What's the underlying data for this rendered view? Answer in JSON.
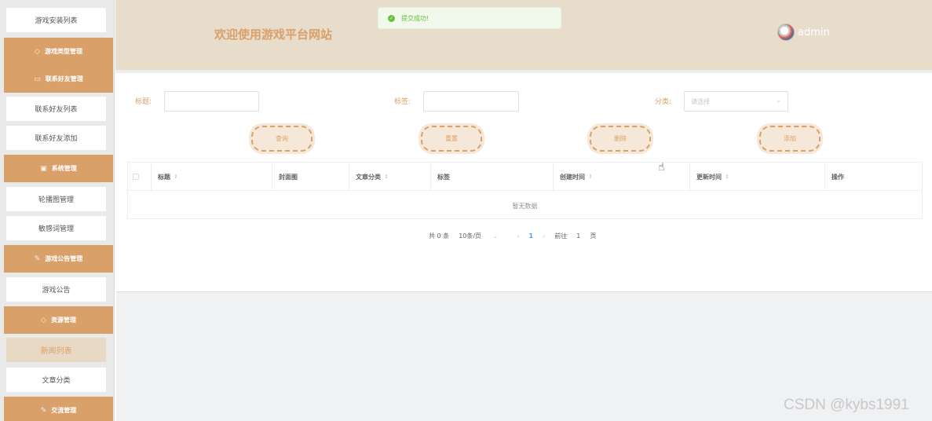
{
  "sidebar": {
    "items": [
      {
        "label": "游戏安装列表"
      },
      {
        "label": "联系好友列表"
      },
      {
        "label": "联系好友添加"
      },
      {
        "label": "轮播图管理"
      },
      {
        "label": "敏感词管理"
      },
      {
        "label": "游戏公告"
      },
      {
        "label": "新闻列表",
        "active": true
      },
      {
        "label": "文章分类"
      }
    ],
    "categories": [
      {
        "label": "游戏类型管理",
        "icon": "layers-icon"
      },
      {
        "label": "联系好友管理",
        "icon": "message-icon"
      },
      {
        "label": "系统管理",
        "icon": "monitor-icon"
      },
      {
        "label": "游戏公告管理",
        "icon": "edit-icon"
      },
      {
        "label": "资源管理",
        "icon": "layers-icon"
      },
      {
        "label": "交流管理",
        "icon": "edit-icon"
      }
    ]
  },
  "header": {
    "welcome": "欢迎使用游戏平台网站",
    "toast": "提交成功!",
    "username": "admin"
  },
  "filters": {
    "title_label": "标题:",
    "tag_label": "标签:",
    "category_label": "分类:",
    "category_placeholder": "请选择"
  },
  "buttons": {
    "query": "查询",
    "reset": "重置",
    "delete": "删除",
    "add": "添加"
  },
  "table": {
    "columns": [
      "标题",
      "封面图",
      "文章分类",
      "标签",
      "创建时间",
      "更新时间",
      "操作"
    ],
    "empty_text": "暂无数据"
  },
  "pagination": {
    "total": "共 0 条",
    "page_size": "10条/页",
    "current_page": "1",
    "goto_label": "前往",
    "goto_value": "1",
    "page_unit": "页"
  },
  "watermark": "CSDN @kybs1991",
  "colors": {
    "accent": "#d9a06a",
    "header_bg": "#e8dccb",
    "success": "#67c23a"
  }
}
